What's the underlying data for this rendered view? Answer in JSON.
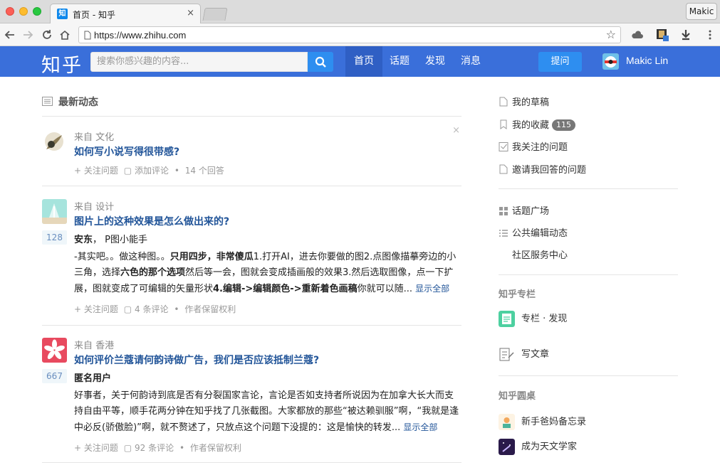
{
  "browser": {
    "tab_favicon": "知",
    "tab_title": "首页 - 知乎",
    "tab_close": "×",
    "profile_label": "Makic",
    "url": "https://www.zhihu.com"
  },
  "header": {
    "logo": "知乎",
    "search_placeholder": "搜索你感兴趣的内容...",
    "nav": [
      "首页",
      "话题",
      "发现",
      "消息"
    ],
    "ask_label": "提问",
    "user_name": "Makic Lin",
    "brand_color": "#3a6fda"
  },
  "feed": {
    "title": "最新动态",
    "items": [
      {
        "source": "来自 文化",
        "title": "如何写小说写得很带感?",
        "meta": [
          "+ 关注问题",
          "添加评论",
          "•",
          "14 个回答"
        ]
      },
      {
        "source": "来自 设计",
        "title": "图片上的这种效果是怎么做出来的?",
        "votes": "128",
        "author": "安东",
        "author_desc": "， P图小能手",
        "excerpt_parts": [
          "-其实吧。。做这种图。。",
          "只用四步，非常傻瓜",
          "1.打开AI，进去你要做的图2.点图像描摹旁边的小三角，选择",
          "六色的那个选项",
          "然后等一会，图就会变成插画般的效果3.然后选取图像，点一下扩展，图就变成了可编辑的矢量形状",
          "4.编辑->编辑颜色->重新着色画稿",
          "你就可以随..."
        ],
        "more": "显示全部",
        "meta": [
          "+ 关注问题",
          "4 条评论",
          "•",
          "作者保留权利"
        ]
      },
      {
        "source": "来自 香港",
        "title": "如何评价兰蔻请何韵诗做广告，我们是否应该抵制兰蔻?",
        "votes": "667",
        "author": "匿名用户",
        "excerpt": "好事者，关于何韵诗到底是否有分裂国家言论，言论是否如支持者所说因为在加拿大长大而支持自由平等，顺手花两分钟在知乎找了几张截图。大家都放的那些“被达赖驯服”啊，“我就是逢中必反(骄傲脸)”啊，就不赘述了，只放点这个问题下没提的：这是愉快的转发...",
        "more": "显示全部",
        "meta": [
          "+ 关注问题",
          "92 条评论",
          "•",
          "作者保留权利"
        ]
      }
    ]
  },
  "sidebar": {
    "links": [
      {
        "label": "我的草稿",
        "icon": "draft-icon"
      },
      {
        "label": "我的收藏",
        "icon": "bookmark-icon",
        "badge": "115"
      },
      {
        "label": "我关注的问题",
        "icon": "checkbox-icon"
      },
      {
        "label": "邀请我回答的问题",
        "icon": "invite-icon"
      }
    ],
    "links2": [
      {
        "label": "话题广场",
        "icon": "grid-icon"
      },
      {
        "label": "公共编辑动态",
        "icon": "list-icon"
      },
      {
        "label": "社区服务中心",
        "icon": ""
      }
    ],
    "column_heading": "知乎专栏",
    "column_apps": [
      {
        "label": "专栏 · 发现",
        "color": "#4dd0a0"
      },
      {
        "label": "写文章",
        "color": "#ffffff"
      }
    ],
    "roundtable_heading": "知乎圆桌",
    "roundtable_apps": [
      {
        "label": "新手爸妈备忘录",
        "color": "#f5e6c8"
      },
      {
        "label": "成为天文学家",
        "color": "#2a1a4a"
      }
    ]
  }
}
